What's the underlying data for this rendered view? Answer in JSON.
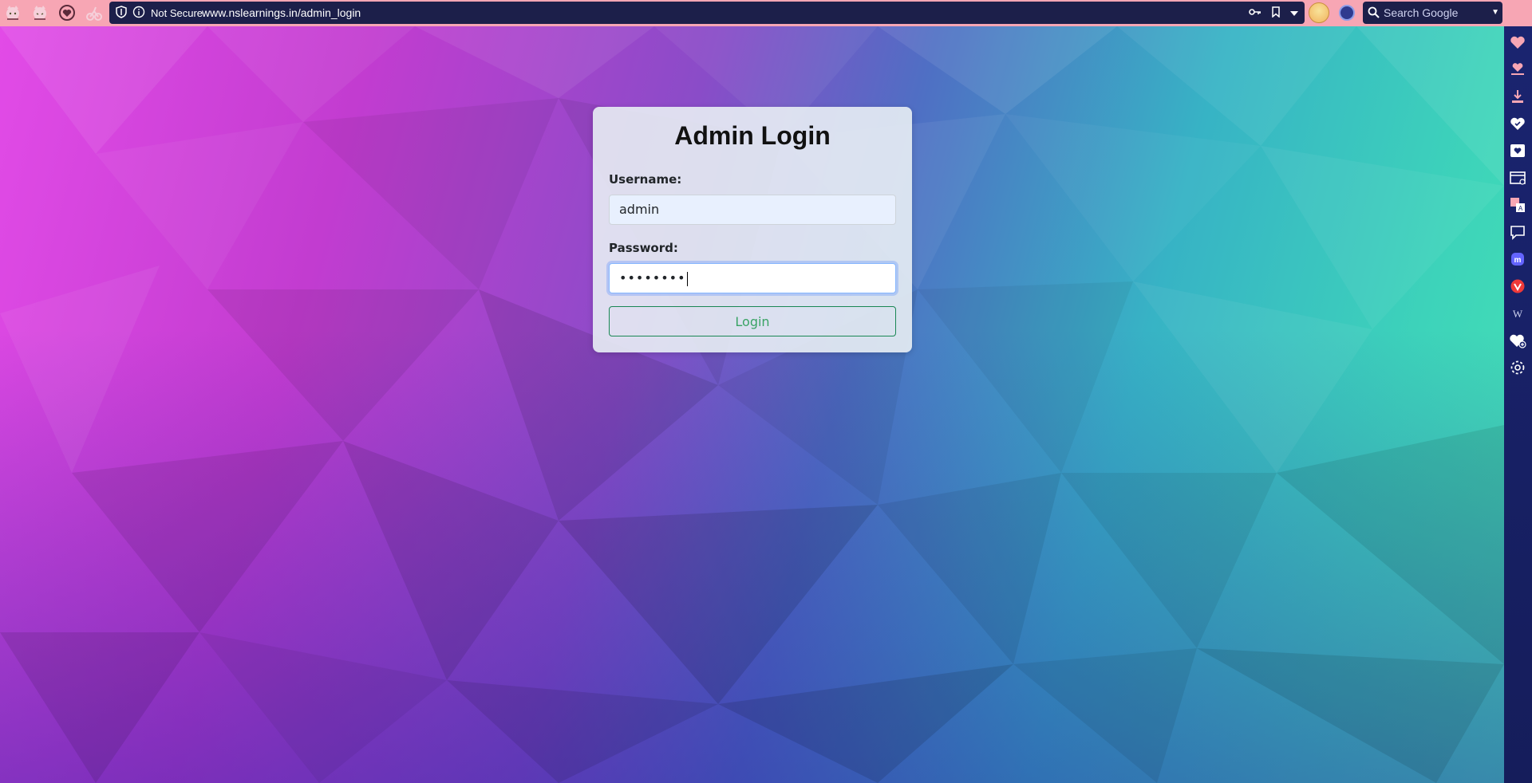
{
  "browser": {
    "security_label": "Not Secure",
    "url": "www.nslearnings.in/admin_login",
    "search_placeholder": "Search Google"
  },
  "login": {
    "title": "Admin Login",
    "username_label": "Username:",
    "username_value": "admin",
    "password_label": "Password:",
    "password_masked": "••••••••",
    "button_label": "Login"
  },
  "colors": {
    "topbar": "#f7a6b4",
    "urlbar": "#1c1f4a",
    "sidebar": "#1a2470",
    "button_border": "#198754",
    "button_text": "#3aa365"
  },
  "icons": {
    "topbar_left": [
      "cat-panel-icon",
      "cat-sidebar-icon",
      "heart-shield-icon",
      "biker-icon"
    ],
    "url_left": [
      "shield-icon",
      "info-icon"
    ],
    "url_right": [
      "key-icon",
      "bookmark-icon",
      "dropdown-icon"
    ],
    "sidebar": [
      "heart-panel-icon",
      "heart-stack-icon",
      "download-icon",
      "heart-sync-icon",
      "heart-box-icon",
      "window-icon",
      "translate-icon",
      "chat-icon",
      "mastodon-icon",
      "vivaldi-icon",
      "wikipedia-icon",
      "heart-add-icon",
      "settings-icon"
    ]
  }
}
